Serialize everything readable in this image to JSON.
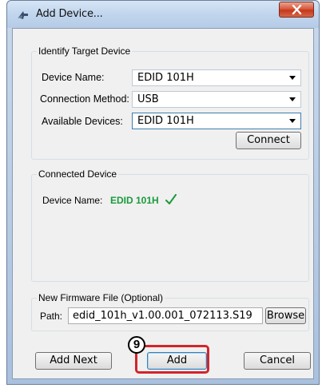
{
  "window": {
    "title": "Add Device...",
    "close_symbol": "x"
  },
  "identify_group": {
    "legend": "Identify Target Device",
    "device_name_label": "Device Name:",
    "device_name_value": "EDID 101H",
    "connection_method_label": "Connection Method:",
    "connection_method_value": "USB",
    "available_devices_label": "Available Devices:",
    "available_devices_value": "EDID 101H",
    "connect_button": "Connect"
  },
  "connected_group": {
    "legend": "Connected Device",
    "device_name_label": "Device Name:",
    "device_name_value": "EDID 101H",
    "status_icon": "check-icon",
    "status_color": "#1a9a3a"
  },
  "firmware_group": {
    "legend": "New Firmware File (Optional)",
    "path_label": "Path:",
    "path_value": "edid_101h_v1.00.001_072113.S19",
    "browse_button": "Browse"
  },
  "footer": {
    "add_next_button": "Add Next",
    "add_button": "Add",
    "cancel_button": "Cancel"
  },
  "annotation": {
    "step_number": "9",
    "highlight_color": "#d3242b"
  }
}
